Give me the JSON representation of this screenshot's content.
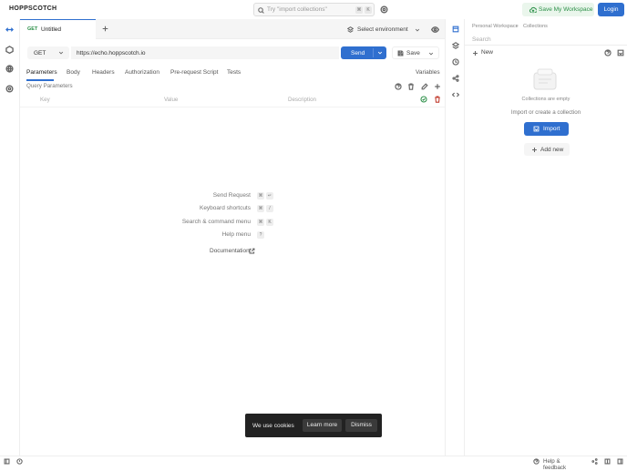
{
  "header": {
    "logo": "HOPPSCOTCH",
    "search_placeholder": "Try \"import collections\"",
    "search_key1": "⌘",
    "search_key2": "K",
    "save_workspace_label": "Save My Workspace",
    "login_label": "Login"
  },
  "tabs": [
    {
      "method": "GET",
      "title": "Untitled"
    }
  ],
  "environment": {
    "label": "Select environment"
  },
  "request": {
    "method": "GET",
    "url": "https://echo.hoppscotch.io",
    "send_label": "Send",
    "save_label": "Save"
  },
  "request_tabs": {
    "parameters": "Parameters",
    "body": "Body",
    "headers": "Headers",
    "authorization": "Authorization",
    "prerequest": "Pre-request Script",
    "tests": "Tests",
    "variables": "Variables"
  },
  "params": {
    "section_title": "Query Parameters",
    "key_placeholder": "Key",
    "value_placeholder": "Value",
    "description_placeholder": "Description"
  },
  "shortcuts": [
    {
      "label": "Send Request",
      "k1": "⌘",
      "k2": "↵"
    },
    {
      "label": "Keyboard shortcuts",
      "k1": "⌘",
      "k2": "/"
    },
    {
      "label": "Search & command menu",
      "k1": "⌘",
      "k2": "K"
    },
    {
      "label": "Help menu",
      "k1": "?",
      "k2": ""
    }
  ],
  "documentation_label": "Documentation",
  "cookie_banner": {
    "text": "We use cookies",
    "learn_more": "Learn more",
    "dismiss": "Dismiss"
  },
  "collections": {
    "breadcrumb_workspace": "Personal Workspace",
    "breadcrumb_section": "Collections",
    "search_placeholder": "Search",
    "new_label": "New",
    "empty_title": "Collections are empty",
    "empty_subtitle": "Import or create a collection",
    "import_label": "Import",
    "add_new_label": "Add new"
  },
  "footer": {
    "help_label": "Help & feedback"
  },
  "colors": {
    "accent": "#2f6fcf",
    "success": "#2b8f47",
    "danger": "#c0392b"
  }
}
